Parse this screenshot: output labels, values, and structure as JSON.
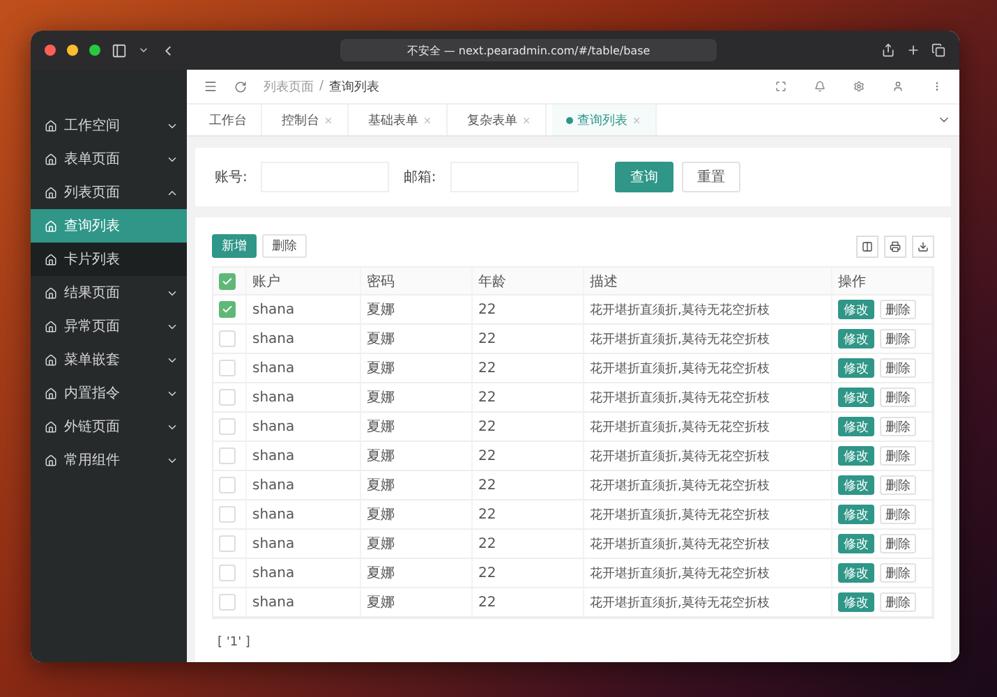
{
  "browser": {
    "address": "不安全 — next.pearadmin.com/#/table/base"
  },
  "sidebar": {
    "items": [
      {
        "label": "工作空间",
        "expanded": false,
        "selected": false
      },
      {
        "label": "表单页面",
        "expanded": false,
        "selected": false
      },
      {
        "label": "列表页面",
        "expanded": true,
        "selected": false,
        "children": [
          {
            "label": "查询列表",
            "selected": true
          },
          {
            "label": "卡片列表",
            "selected": false
          }
        ]
      },
      {
        "label": "结果页面",
        "expanded": false,
        "selected": false
      },
      {
        "label": "异常页面",
        "expanded": false,
        "selected": false
      },
      {
        "label": "菜单嵌套",
        "expanded": false,
        "selected": false
      },
      {
        "label": "内置指令",
        "expanded": false,
        "selected": false
      },
      {
        "label": "外链页面",
        "expanded": false,
        "selected": false
      },
      {
        "label": "常用组件",
        "expanded": false,
        "selected": false
      }
    ]
  },
  "breadcrumb": {
    "items": [
      "列表页面",
      "查询列表"
    ],
    "separator": "/"
  },
  "tabs": [
    {
      "label": "工作台",
      "selected": false,
      "closable": false
    },
    {
      "label": "控制台",
      "selected": false,
      "closable": true
    },
    {
      "label": "基础表单",
      "selected": false,
      "closable": true
    },
    {
      "label": "复杂表单",
      "selected": false,
      "closable": true
    },
    {
      "label": "查询列表",
      "selected": true,
      "closable": true
    }
  ],
  "search_form": {
    "fields": [
      {
        "label": "账号:"
      },
      {
        "label": "邮箱:"
      }
    ],
    "buttons": [
      {
        "label": "查询",
        "kind": "primary"
      },
      {
        "label": "重置",
        "kind": "default"
      }
    ]
  },
  "toolbar": {
    "buttons": [
      {
        "label": "新增",
        "kind": "primary"
      },
      {
        "label": "删除",
        "kind": "default"
      }
    ]
  },
  "table": {
    "all_checked": true,
    "columns": [
      "账户",
      "密码",
      "年龄",
      "描述",
      "操作"
    ],
    "rows": [
      {
        "checked": true,
        "cells": [
          "shana",
          "夏娜",
          "22",
          "花开堪折直须折,莫待无花空折枝"
        ],
        "actions": [
          "修改",
          "删除"
        ]
      },
      {
        "checked": false,
        "cells": [
          "shana",
          "夏娜",
          "22",
          "花开堪折直须折,莫待无花空折枝"
        ],
        "actions": [
          "修改",
          "删除"
        ]
      },
      {
        "checked": false,
        "cells": [
          "shana",
          "夏娜",
          "22",
          "花开堪折直须折,莫待无花空折枝"
        ],
        "actions": [
          "修改",
          "删除"
        ]
      },
      {
        "checked": false,
        "cells": [
          "shana",
          "夏娜",
          "22",
          "花开堪折直须折,莫待无花空折枝"
        ],
        "actions": [
          "修改",
          "删除"
        ]
      },
      {
        "checked": false,
        "cells": [
          "shana",
          "夏娜",
          "22",
          "花开堪折直须折,莫待无花空折枝"
        ],
        "actions": [
          "修改",
          "删除"
        ]
      },
      {
        "checked": false,
        "cells": [
          "shana",
          "夏娜",
          "22",
          "花开堪折直须折,莫待无花空折枝"
        ],
        "actions": [
          "修改",
          "删除"
        ]
      },
      {
        "checked": false,
        "cells": [
          "shana",
          "夏娜",
          "22",
          "花开堪折直须折,莫待无花空折枝"
        ],
        "actions": [
          "修改",
          "删除"
        ]
      },
      {
        "checked": false,
        "cells": [
          "shana",
          "夏娜",
          "22",
          "花开堪折直须折,莫待无花空折枝"
        ],
        "actions": [
          "修改",
          "删除"
        ]
      },
      {
        "checked": false,
        "cells": [
          "shana",
          "夏娜",
          "22",
          "花开堪折直须折,莫待无花空折枝"
        ],
        "actions": [
          "修改",
          "删除"
        ]
      },
      {
        "checked": false,
        "cells": [
          "shana",
          "夏娜",
          "22",
          "花开堪折直须折,莫待无花空折枝"
        ],
        "actions": [
          "修改",
          "删除"
        ]
      },
      {
        "checked": false,
        "cells": [
          "shana",
          "夏娜",
          "22",
          "花开堪折直须折,莫待无花空折枝"
        ],
        "actions": [
          "修改",
          "删除"
        ]
      }
    ],
    "footer": "[ '1' ]"
  }
}
